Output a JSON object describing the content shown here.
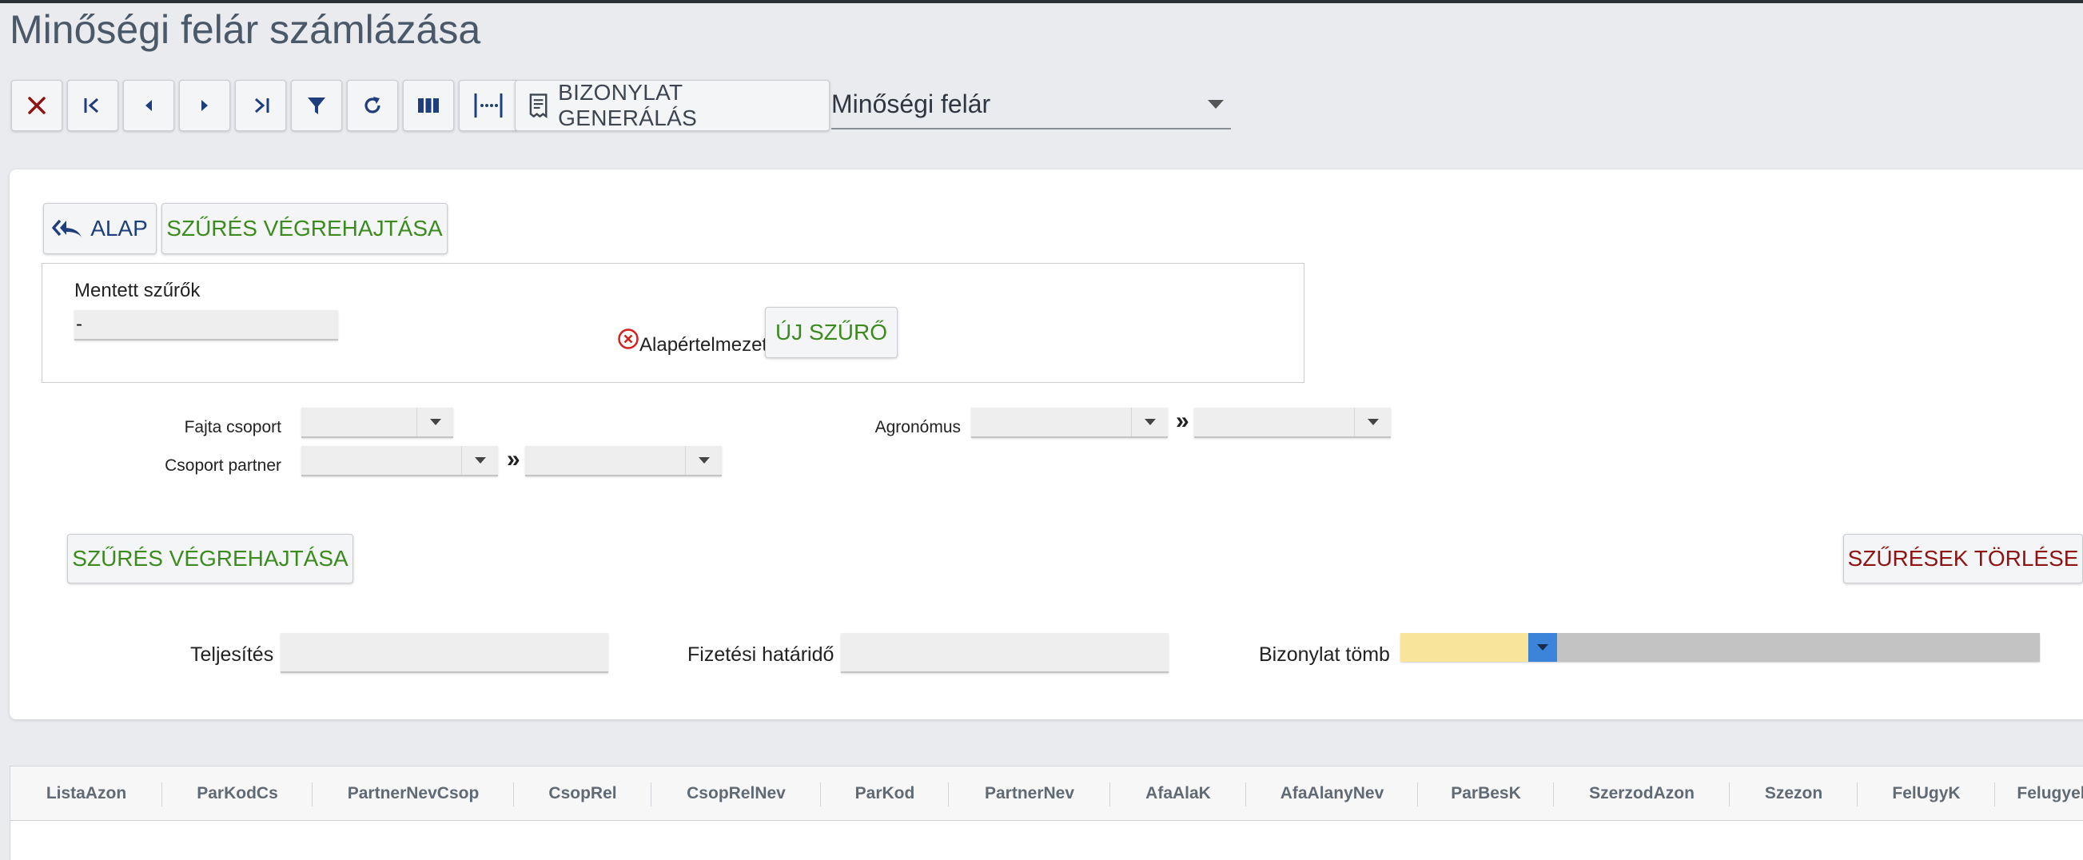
{
  "page": {
    "title": "Minőségi felár számlázása"
  },
  "toolbar": {
    "generate_label": "BIZONYLAT GENERÁLÁS",
    "mode_value": "Minőségi felár"
  },
  "filter": {
    "alap_label": "ALAP",
    "execute_label_top": "SZŰRÉS VÉGREHAJTÁSA",
    "saved_filters_label": "Mentett szűrők",
    "saved_filters_value": "-",
    "default_label": "Alapértelmezett?",
    "new_filter_label": "ÚJ SZŰRŐ",
    "fajta_csoport_label": "Fajta csoport",
    "csoport_partner_label": "Csoport partner",
    "agronomus_label": "Agronómus",
    "range_sep": "»",
    "execute_label_bottom": "SZŰRÉS VÉGREHAJTÁSA",
    "clear_filters_label": "SZŰRÉSEK TÖRLÉSE"
  },
  "form": {
    "teljesites_label": "Teljesítés",
    "fizetesi_label": "Fizetési határidő",
    "bizonylat_tomb_label": "Bizonylat tömb"
  },
  "grid": {
    "columns": [
      "ListaAzon",
      "ParKodCs",
      "PartnerNevCsop",
      "CsopRel",
      "CsopRelNev",
      "ParKod",
      "PartnerNev",
      "AfaAlaK",
      "AfaAlanyNev",
      "ParBesK",
      "SzerzodAzon",
      "Szezon",
      "FelUgyK",
      "Felugyel"
    ]
  },
  "colors": {
    "accent_green": "#3c8b1f",
    "accent_red": "#8e1414",
    "accent_navy": "#1f3e7c",
    "tomb_yellow": "#f8e59a",
    "tomb_blue": "#3b84d9"
  }
}
